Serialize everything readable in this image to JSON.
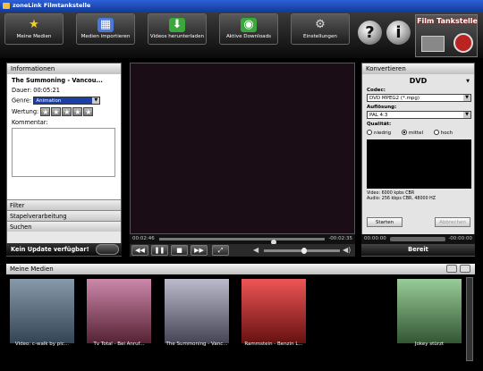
{
  "window": {
    "title": "zoneLink Filmtankstelle"
  },
  "toolbar": {
    "buttons": [
      {
        "label": "Meine Medien",
        "icon": "star-icon",
        "color": "#f5d020"
      },
      {
        "label": "Medien importieren",
        "icon": "film-icon",
        "color": "#4a78d8"
      },
      {
        "label": "Videos herunterladen",
        "icon": "download-icon",
        "color": "#3aa83a"
      },
      {
        "label": "Aktive Downloads",
        "icon": "globe-icon",
        "color": "#3aa83a"
      },
      {
        "label": "Einstellungen",
        "icon": "settings-icon",
        "color": "#bbbbbb"
      }
    ],
    "help": "?",
    "info": "i"
  },
  "logo": {
    "text": "Film Tankstelle"
  },
  "info_panel": {
    "header": "Informationen",
    "title": "The Summoning - Vancou...",
    "duration_label": "Dauer:",
    "duration": "00:05:21",
    "genre_label": "Genre:",
    "genre": "Animation",
    "rating_label": "Wertung:",
    "rating": 0,
    "comment_label": "Kommentar:"
  },
  "accordion": [
    "Filter",
    "Stapelverarbeitung",
    "Suchen"
  ],
  "update": {
    "text": "Kein Update verfügbar!"
  },
  "player": {
    "elapsed": "00:02:46",
    "remaining": "-00:02:35",
    "progress": 0.52,
    "volume": 0.5
  },
  "convert": {
    "header": "Konvertieren",
    "format": "DVD",
    "codec_label": "Codec:",
    "codec": "DVD MPEG2 (*.mpg)",
    "resolution_label": "Auflösung:",
    "resolution": "PAL 4:3",
    "quality_label": "Qualität:",
    "quality_options": [
      "niedrig",
      "mittel",
      "hoch"
    ],
    "quality_selected": "mittel",
    "video_info": "Video: 6000 kpbs CBR",
    "audio_info": "Audio: 256 kbps CBR, 48000 HZ",
    "start": "Starten",
    "cancel": "Abbrechen",
    "time_left": "00:00:00",
    "time_right": "-00:00:00",
    "status": "Bereit"
  },
  "media": {
    "header": "Meine Medien",
    "items": [
      {
        "caption": "Video: c-walk by pic...",
        "color": "#567"
      },
      {
        "caption": "Tv Total - Bei Anruf...",
        "color": "#a57"
      },
      {
        "caption": "The Summoning - Vanc...",
        "color": "#889"
      },
      {
        "caption": "Rammstein - Benzin L...",
        "color": "#b33"
      },
      {
        "caption": "Jokey stürzt",
        "color": "#5a5"
      }
    ]
  }
}
